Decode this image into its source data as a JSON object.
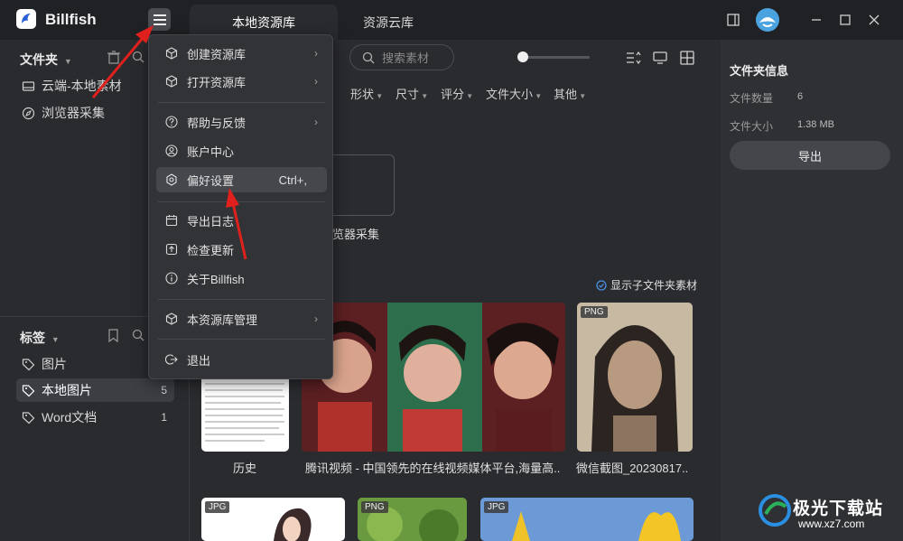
{
  "app": {
    "name": "Billfish"
  },
  "tabs": [
    {
      "label": "本地资源库"
    },
    {
      "label": "资源云库"
    }
  ],
  "sidebar": {
    "folders_title": "文件夹",
    "folders": [
      {
        "label": "云端-本地素材"
      },
      {
        "label": "浏览器采集"
      }
    ],
    "tags_title": "标签",
    "tags": [
      {
        "label": "图片",
        "count": ""
      },
      {
        "label": "本地图片",
        "count": "5"
      },
      {
        "label": "Word文档",
        "count": "1"
      }
    ]
  },
  "toolbar": {
    "search_placeholder": "搜索素材"
  },
  "filters": [
    "形状",
    "尺寸",
    "评分",
    "文件大小",
    "其他"
  ],
  "main": {
    "folder_label": "览器采集",
    "subfolder_toggle": "显示子文件夹素材",
    "items": [
      {
        "caption": "历史",
        "badge": ""
      },
      {
        "caption": "腾讯视频 - 中国领先的在线视频媒体平台,海量高..",
        "badge": ""
      },
      {
        "caption": "微信截图_20230817..",
        "badge": "PNG"
      },
      {
        "caption": "",
        "badge": "JPG"
      },
      {
        "caption": "",
        "badge": "PNG"
      },
      {
        "caption": "",
        "badge": "JPG"
      }
    ]
  },
  "menu": {
    "items": [
      {
        "label": "创建资源库",
        "icon": "cube-icon",
        "submenu": true
      },
      {
        "label": "打开资源库",
        "icon": "cube-icon",
        "submenu": true
      },
      {
        "label": "帮助与反馈",
        "icon": "help-icon",
        "submenu": true
      },
      {
        "label": "账户中心",
        "icon": "user-icon",
        "submenu": false
      },
      {
        "label": "偏好设置",
        "icon": "settings-icon",
        "shortcut": "Ctrl+,",
        "submenu": false
      },
      {
        "label": "导出日志",
        "icon": "calendar-icon",
        "submenu": false
      },
      {
        "label": "检查更新",
        "icon": "update-icon",
        "submenu": false
      },
      {
        "label": "关于Billfish",
        "icon": "info-icon",
        "submenu": false
      },
      {
        "label": "本资源库管理",
        "icon": "cube-icon",
        "submenu": true
      },
      {
        "label": "退出",
        "icon": "logout-icon",
        "submenu": false
      }
    ]
  },
  "right_panel": {
    "title": "文件夹信息",
    "count_label": "文件数量",
    "count_value": "6",
    "size_label": "文件大小",
    "size_value": "1.38 MB",
    "export_label": "导出"
  },
  "watermark": {
    "text": "极光下载站",
    "url": "www.xz7.com"
  },
  "colors": {
    "accent": "#4a90e2",
    "annotation_arrow": "#e0201c",
    "background": "#2a2b2f"
  }
}
